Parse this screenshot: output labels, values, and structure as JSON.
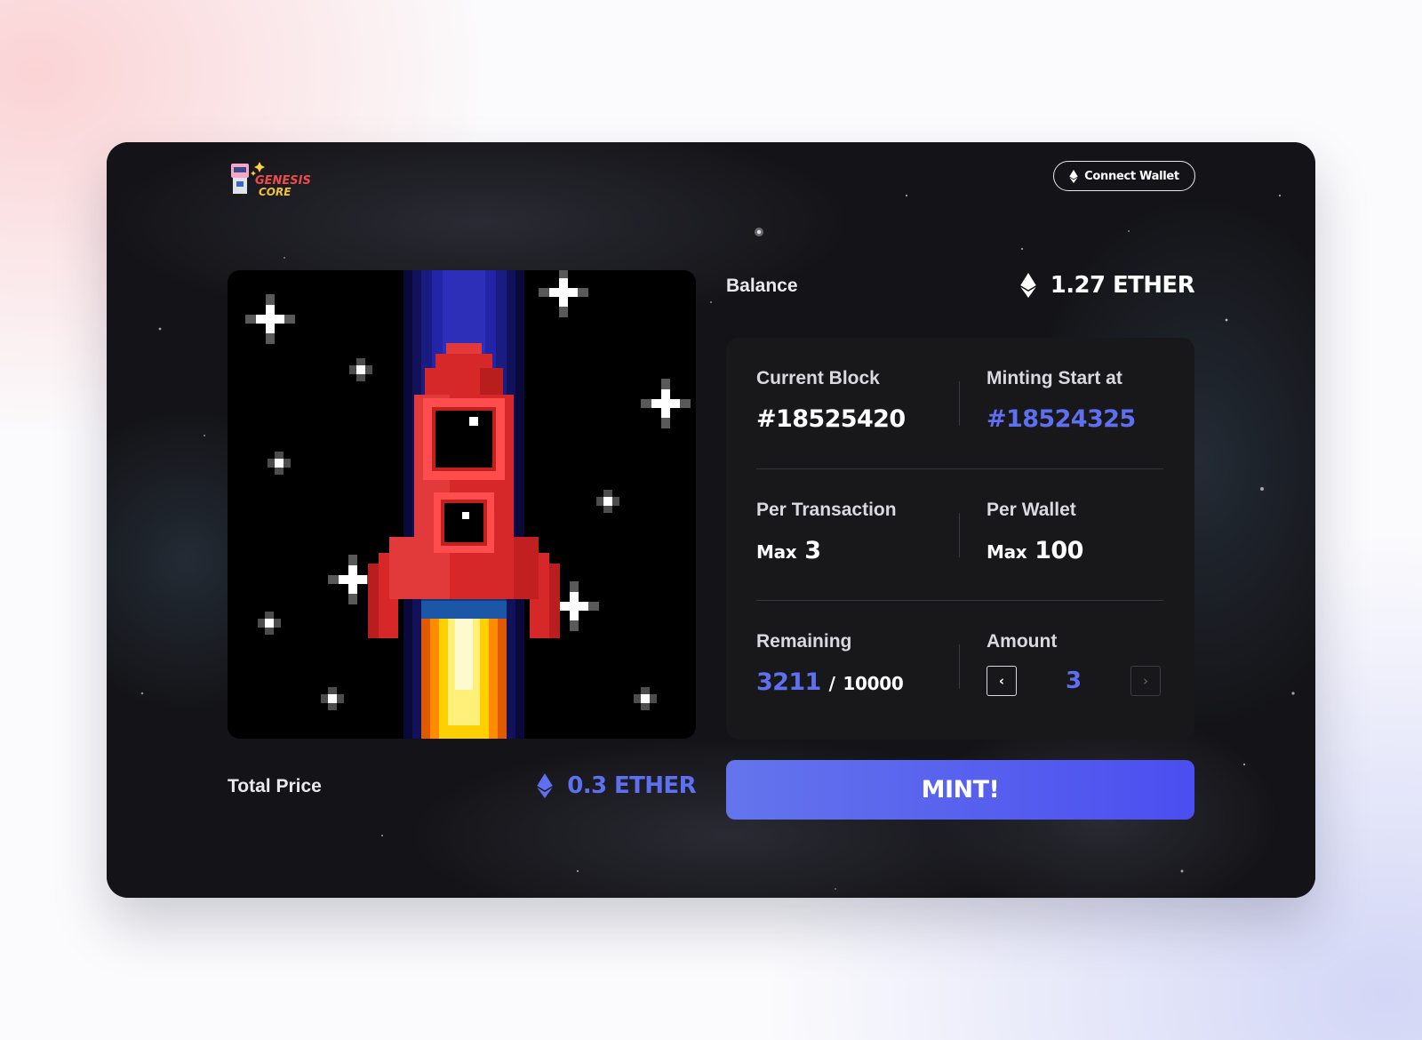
{
  "brand": {
    "logo_line1": "GENESIS",
    "logo_line2": "CORE"
  },
  "header": {
    "connect_label": "Connect Wallet",
    "connect_icon": "ethereum-icon"
  },
  "balance": {
    "label": "Balance",
    "value": "1.27 ETHER",
    "icon": "ethereum-icon"
  },
  "stats": {
    "current_block": {
      "label": "Current Block",
      "value": "#18525420"
    },
    "minting_start": {
      "label": "Minting Start at",
      "value": "#18524325"
    },
    "per_transaction": {
      "label": "Per Transaction",
      "prefix": "Max",
      "value": "3"
    },
    "per_wallet": {
      "label": "Per Wallet",
      "prefix": "Max",
      "value": "100"
    },
    "remaining": {
      "label": "Remaining",
      "value": "3211",
      "separator": "/",
      "total": "10000"
    },
    "amount": {
      "label": "Amount",
      "value": "3",
      "decrement": "‹",
      "increment": "›"
    }
  },
  "total": {
    "label": "Total Price",
    "value": "0.3 ETHER",
    "icon": "ethereum-icon"
  },
  "mint": {
    "label": "MINT!"
  },
  "colors": {
    "accent": "#5e6ff0",
    "card_bg": "#121216",
    "panel_bg": "#18181b"
  }
}
